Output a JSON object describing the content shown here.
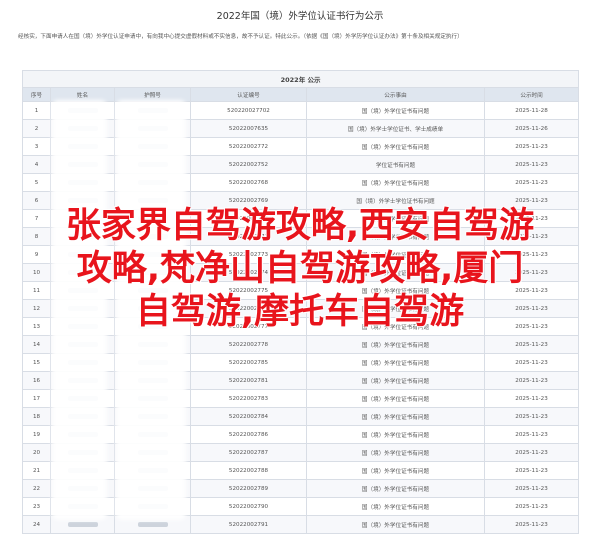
{
  "header": {
    "title": "2022年国（境）外学位认证书行为公示",
    "intro": "经核实，下面申请人在国（境）外学位认证申请中，有向我中心提交虚假材料或不实信息，故不予认证。特此公示。（依据《国（境）外学历学位认证办法》第十条及相关规定执行）"
  },
  "table": {
    "title": "2022年 公示",
    "columns": [
      "序号",
      "姓名",
      "护照号",
      "认证编号",
      "公示事由",
      "公示时间"
    ],
    "rows": [
      {
        "no": "1",
        "cert": "52022002770‌2",
        "reason": "国（境）外学位证书有问题",
        "date": "2025-11-28"
      },
      {
        "no": "2",
        "cert": "52022007635",
        "reason": "国（境）外学士学位证书、学士成绩单",
        "date": "2025-11-26"
      },
      {
        "no": "3",
        "cert": "52022002772",
        "reason": "国（境）外学位证书有问题",
        "date": "2025-11-23"
      },
      {
        "no": "4",
        "cert": "52022002752",
        "reason": "学位证书有问题",
        "date": "2025-11-23"
      },
      {
        "no": "5",
        "cert": "52022002768",
        "reason": "国（境）外学位证书有问题",
        "date": "2025-11-23"
      },
      {
        "no": "6",
        "cert": "52022002769",
        "reason": "国（境）外学士学位证书有问题",
        "date": "2025-11-23"
      },
      {
        "no": "7",
        "cert": "52022002770",
        "reason": "国（境）外学位证书有问题",
        "date": "2025-11-23"
      },
      {
        "no": "8",
        "cert": "52022002771",
        "reason": "国（境）外学位证书有问题",
        "date": "2025-11-23"
      },
      {
        "no": "9",
        "cert": "52022002773",
        "reason": "国（境）外学位证书有问题",
        "date": "2025-11-23"
      },
      {
        "no": "10",
        "cert": "52022002774",
        "reason": "国（境）外学位证书有问题",
        "date": "2025-11-23"
      },
      {
        "no": "11",
        "cert": "52022002775",
        "reason": "国（境）外学位证书有问题",
        "date": "2025-11-23"
      },
      {
        "no": "12",
        "cert": "52022002776",
        "reason": "国（境）外学位证书有问题",
        "date": "2025-11-23"
      },
      {
        "no": "13",
        "cert": "52022002777",
        "reason": "国（境）外学位证书有问题",
        "date": "2025-11-23"
      },
      {
        "no": "14",
        "cert": "52022002778",
        "reason": "国（境）外学位证书有问题",
        "date": "2025-11-23"
      },
      {
        "no": "15",
        "cert": "52022002785",
        "reason": "国（境）外学位证书有问题",
        "date": "2025-11-23"
      },
      {
        "no": "16",
        "cert": "52022002781",
        "reason": "国（境）外学位证书有问题",
        "date": "2025-11-23"
      },
      {
        "no": "17",
        "cert": "52022002783",
        "reason": "国（境）外学位证书有问题",
        "date": "2025-11-23"
      },
      {
        "no": "18",
        "cert": "52022002784",
        "reason": "国（境）外学位证书有问题",
        "date": "2025-11-23"
      },
      {
        "no": "19",
        "cert": "52022002786",
        "reason": "国（境）外学位证书有问题",
        "date": "2025-11-23"
      },
      {
        "no": "20",
        "cert": "52022002787",
        "reason": "国（境）外学位证书有问题",
        "date": "2025-11-23"
      },
      {
        "no": "21",
        "cert": "52022002788",
        "reason": "国（境）外学位证书有问题",
        "date": "2025-11-23"
      },
      {
        "no": "22",
        "cert": "52022002789",
        "reason": "国（境）外学位证书有问题",
        "date": "2025-11-23"
      },
      {
        "no": "23",
        "cert": "52022002790",
        "reason": "国（境）外学位证书有问题",
        "date": "2025-11-23"
      },
      {
        "no": "24",
        "cert": "52022002791",
        "reason": "国（境）外学位证书有问题",
        "date": "2025-11-23"
      }
    ]
  },
  "overlay": {
    "line1": "张家界自驾游攻略,西安自驾游",
    "line2": "攻略,梵净山自驾游攻略,厦门",
    "line3": "自驾游,摩托车自驾游"
  },
  "colors": {
    "overlay_text": "#e8141c",
    "table_header_bg": "#dfe6ef",
    "table_border": "#d8dde5"
  }
}
